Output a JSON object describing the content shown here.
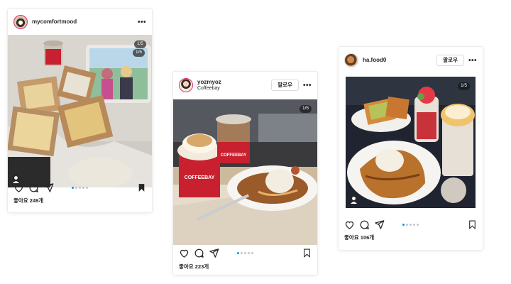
{
  "posts": [
    {
      "username": "mycomfortmood",
      "subtitle": "",
      "follow_label": "",
      "more_icon": "more-horizontal-icon",
      "image_counter": "1/5",
      "inset_counter": "1/5",
      "likes": "좋아요 249개",
      "carousel_total": 5,
      "carousel_active": 1,
      "has_tag_icon": true
    },
    {
      "username": "yozmyoz",
      "subtitle": "Coffeebay",
      "follow_label": "팔로우",
      "more_icon": "more-horizontal-icon",
      "image_counter": "1/5",
      "cup_text": "COFFEEBAY",
      "likes": "좋아요 223개",
      "carousel_total": 5,
      "carousel_active": 1,
      "has_tag_icon": false
    },
    {
      "username": "ha.food0",
      "subtitle": "",
      "follow_label": "팔로우",
      "more_icon": "more-horizontal-icon",
      "image_counter": "1/5",
      "likes": "좋아요 106개",
      "carousel_total": 5,
      "carousel_active": 1,
      "has_tag_icon": true
    }
  ],
  "icons": [
    "heart-icon",
    "comment-icon",
    "share-icon",
    "bookmark-icon",
    "person-tag-icon"
  ],
  "colors": {
    "accent_dot": "#0095f6",
    "inactive_dot": "#c7c7c7",
    "text": "#262626",
    "story_ring": "#e1306c"
  }
}
